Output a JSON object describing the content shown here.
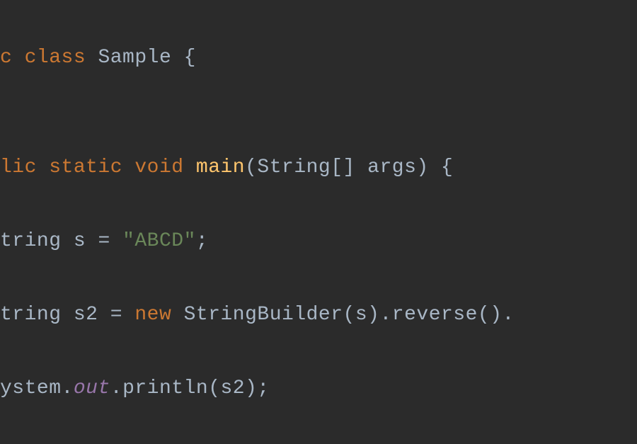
{
  "code": {
    "line1": {
      "prefix": "c ",
      "kw_class": "class",
      "space1": " ",
      "classname": "Sample",
      "space2": " ",
      "brace": "{"
    },
    "line3": {
      "prefix": "lic ",
      "kw_static": "static",
      "space1": " ",
      "kw_void": "void",
      "space2": " ",
      "method": "main",
      "paren_open": "(",
      "type": "String",
      "brackets": "[] ",
      "param": "args",
      "paren_close": ")",
      "space3": " ",
      "brace": "{"
    },
    "line4": {
      "prefix": "tring ",
      "var": "s",
      "eq": " = ",
      "str": "\"ABCD\"",
      "semi": ";"
    },
    "line5": {
      "prefix": "tring ",
      "var": "s2",
      "eq": " = ",
      "kw_new": "new",
      "space1": " ",
      "ctor": "StringBuilder",
      "paren_open1": "(",
      "arg": "s",
      "paren_close1": ")",
      "dot1": ".",
      "m1": "reverse",
      "parens1": "()",
      "dot2": "."
    },
    "line6": {
      "prefix": "ystem",
      "dot1": ".",
      "out": "out",
      "dot2": ".",
      "m": "println",
      "paren_open": "(",
      "arg": "s2",
      "paren_close": ")",
      "semi": ";"
    }
  }
}
